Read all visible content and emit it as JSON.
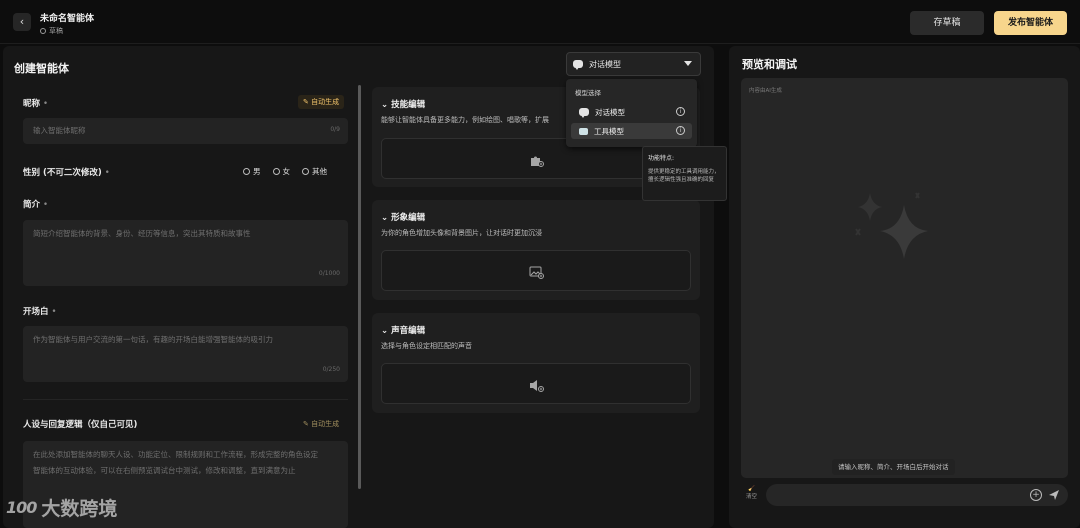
{
  "header": {
    "app_title": "未命名智能体",
    "status": "草稿",
    "save_draft_label": "存草稿",
    "publish_label": "发布智能体",
    "back_icon": "chevron-left-icon"
  },
  "editor": {
    "title": "创建智能体",
    "model_select": {
      "selected": "对话模型",
      "menu_heading": "模型选择",
      "options": [
        {
          "label": "对话模型",
          "icon": "chat-bubble-icon"
        },
        {
          "label": "工具模型",
          "icon": "tool-icon"
        }
      ],
      "tooltip_title": "功能特点:",
      "tooltip_body": "提供更稳定的工具调用能力，擅长逻辑性强且准确的回复"
    },
    "form": {
      "nickname": {
        "label": "昵称",
        "placeholder": "输入智能体昵称",
        "counter": "0/9",
        "auto_generate": "自动生成"
      },
      "gender": {
        "label": "性别 (不可二次修改)",
        "options": [
          "男",
          "女",
          "其他"
        ]
      },
      "intro": {
        "label": "简介",
        "placeholder": "简短介绍智能体的背景、身份、经历等信息，突出其特质和故事性",
        "counter": "0/1000"
      },
      "opening": {
        "label": "开场白",
        "placeholder": "作为智能体与用户交流的第一句话，有趣的开场白能增强智能体的吸引力",
        "counter": "0/250"
      },
      "persona": {
        "label": "人设与回复逻辑（仅自己可见)",
        "auto_generate": "自动生成",
        "placeholder_1": "在此处添加智能体的聊天人设、功能定位、限制规则和工作流程，形成完整的角色设定",
        "placeholder_2": "智能体的互动体验，可以在右侧预览调试台中测试，修改和调整，直到满意为止"
      }
    },
    "sections": {
      "skills": {
        "title": "技能编辑",
        "desc": "能够让智能体具备更多能力，例如绘图、唱歌等，扩展"
      },
      "image": {
        "title": "形象编辑",
        "desc": "为你的角色增加头像和背景图片，让对话时更加沉浸"
      },
      "voice": {
        "title": "声音编辑",
        "desc": "选择与角色设定相匹配的声音"
      }
    }
  },
  "preview": {
    "title": "预览和调试",
    "ai_note": "内容由AI生成",
    "hint": "请输入昵称、简介、开场白后开始对话",
    "clear_label": "清空",
    "input_placeholder": ""
  },
  "watermark": {
    "logo": "100",
    "text": "大数跨境"
  },
  "colors": {
    "accent": "#f7d58c",
    "background": "#0d0d0d",
    "panel": "#171717"
  }
}
